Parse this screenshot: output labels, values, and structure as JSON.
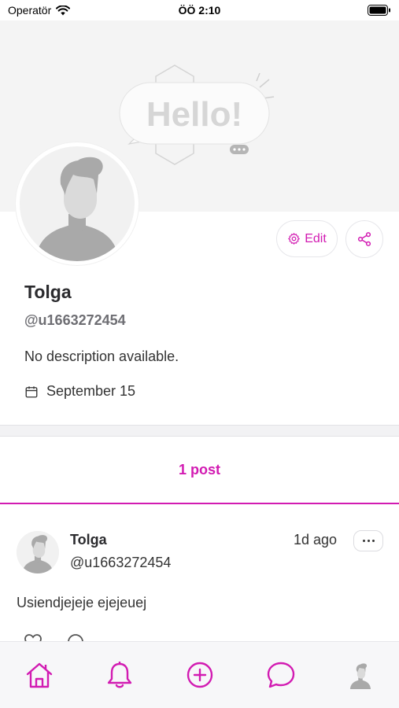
{
  "status_bar": {
    "carrier": "Operatör",
    "time": "ÖÖ 2:10"
  },
  "cover": {
    "art_text": "Hello!"
  },
  "profile": {
    "name": "Tolga",
    "handle": "@u1663272454",
    "description": "No description available.",
    "joined": "September 15",
    "edit_label": "Edit"
  },
  "tabs": {
    "posts_label": "1 post"
  },
  "post": {
    "author": "Tolga",
    "handle": "@u1663272454",
    "time": "1d ago",
    "text": "Usiendjejeje ejejeuej"
  },
  "colors": {
    "accent": "#d21bb2",
    "cover_bg": "#f4f4f4",
    "nav_bg": "#f7f7f9"
  },
  "icons": {
    "status": [
      "wifi-icon",
      "battery-icon"
    ],
    "profile": [
      "gear-icon",
      "share-icon",
      "calendar-icon"
    ],
    "post": [
      "more-icon",
      "heart-icon",
      "comment-icon"
    ],
    "nav": [
      "home-icon",
      "bell-icon",
      "plus-circle-icon",
      "chat-bubble-icon",
      "profile-avatar-icon"
    ]
  }
}
